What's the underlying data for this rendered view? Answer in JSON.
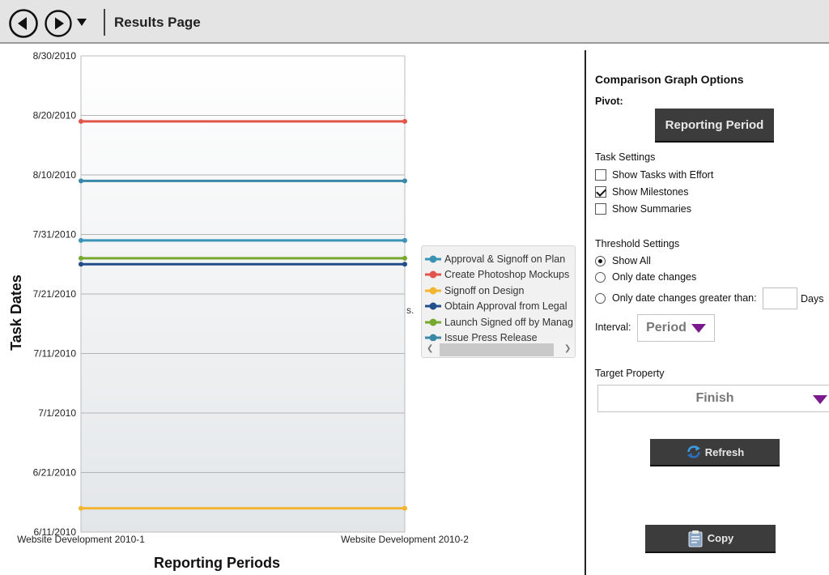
{
  "toolbar": {
    "title": "Results Page",
    "back_icon": "back-arrow-icon",
    "forward_icon": "forward-arrow-icon",
    "history_icon": "chevron-down-icon"
  },
  "chart_data": {
    "type": "line",
    "ylabel": "Task Dates",
    "xlabel": "Reporting Periods",
    "categories": [
      "Website Development 2010-1",
      "Website Development 2010-2"
    ],
    "y_ticks": [
      "8/30/2010",
      "8/20/2010",
      "8/10/2010",
      "7/31/2010",
      "7/21/2010",
      "7/11/2010",
      "7/1/2010",
      "6/21/2010",
      "6/11/2010"
    ],
    "ylim": [
      "2010-06-11",
      "2010-08-30"
    ],
    "grid": true,
    "legend_placement": "right",
    "series": [
      {
        "name": "Approval & Signoff on Plan",
        "color": "#3a93b4",
        "values": [
          "2010-07-30",
          "2010-07-30"
        ]
      },
      {
        "name": "Create Photoshop Mockups",
        "color": "#e0564a",
        "values": [
          "2010-08-19",
          "2010-08-19"
        ]
      },
      {
        "name": "Signoff on Design",
        "color": "#f2b530",
        "values": [
          "2010-06-15",
          "2010-06-15"
        ]
      },
      {
        "name": "Obtain Approval from Legal",
        "color": "#234e8c",
        "values": [
          "2010-07-26",
          "2010-07-26"
        ]
      },
      {
        "name": "Launch Signed off by Manag",
        "color": "#77a830",
        "values": [
          "2010-07-27",
          "2010-07-27"
        ]
      },
      {
        "name": "Issue Press Release",
        "color": "#3a88a8",
        "values": [
          "2010-08-09",
          "2010-08-09"
        ]
      }
    ]
  },
  "chart_stray_text": "s.",
  "options": {
    "heading": "Comparison Graph Options",
    "pivot_label": "Pivot:",
    "pivot_button": "Reporting Period",
    "task_settings_label": "Task Settings",
    "show_tasks_with_effort": "Show Tasks with Effort",
    "show_milestones": "Show Milestones",
    "show_summaries": "Show Summaries",
    "threshold_label": "Threshold Settings",
    "show_all": "Show All",
    "only_date_changes": "Only date changes",
    "only_date_changes_greater": "Only date changes greater than:",
    "days_value": "",
    "days_label": "Days",
    "interval_label": "Interval:",
    "interval_value": "Period",
    "target_property_label": "Target Property",
    "target_property_value": "Finish",
    "refresh_button": "Refresh",
    "copy_button": "Copy",
    "accent_color": "#7a1a8c"
  }
}
